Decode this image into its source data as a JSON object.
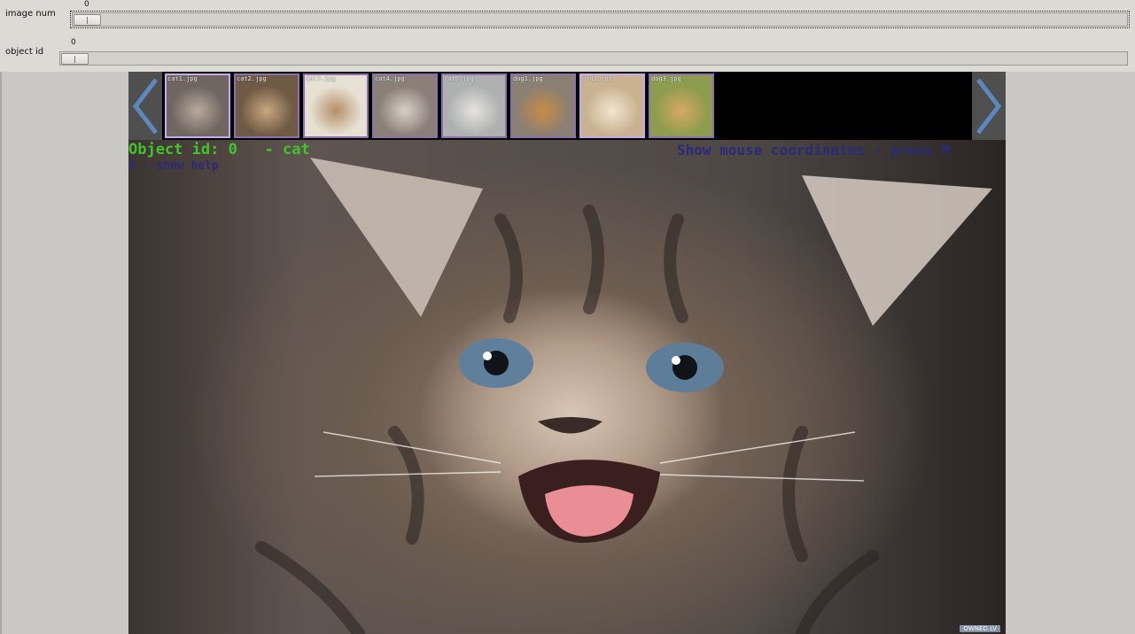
{
  "sliders": [
    {
      "label": "image num",
      "value": "0",
      "fraction": 0
    },
    {
      "label": "object id",
      "value": "0",
      "fraction": 0
    }
  ],
  "thumbnails": [
    {
      "name": "cat1.jpg",
      "selected": true,
      "color_a": "#6f6660",
      "color_b": "#b8aa9c"
    },
    {
      "name": "cat2.jpg",
      "selected": false,
      "color_a": "#6e5a45",
      "color_b": "#c9a77f"
    },
    {
      "name": "cat3.jpg",
      "selected": false,
      "color_a": "#e7e1d4",
      "color_b": "#b59067"
    },
    {
      "name": "cat4.jpg",
      "selected": false,
      "color_a": "#8a8077",
      "color_b": "#d9d1c8"
    },
    {
      "name": "cat5.jpg",
      "selected": false,
      "color_a": "#aeb1b0",
      "color_b": "#e5e3e0"
    },
    {
      "name": "dog1.jpg",
      "selected": false,
      "color_a": "#8a7f73",
      "color_b": "#c88c45"
    },
    {
      "name": "dog2.jpg",
      "selected": true,
      "color_a": "#c9b28f",
      "color_b": "#f1e6d1"
    },
    {
      "name": "dog3.jpg",
      "selected": false,
      "color_a": "#8d9c4e",
      "color_b": "#d8a963"
    }
  ],
  "overlay": {
    "object_text": "Object id: 0   - cat",
    "mouse_text": "Show mouse coordinates - press M",
    "help_text": "h - show help"
  },
  "watermark": "OWNED.LV",
  "colors": {
    "object_text": "#43c42a",
    "hint_text": "#2a2a7a",
    "nav_arrow": "#5b89bf"
  }
}
